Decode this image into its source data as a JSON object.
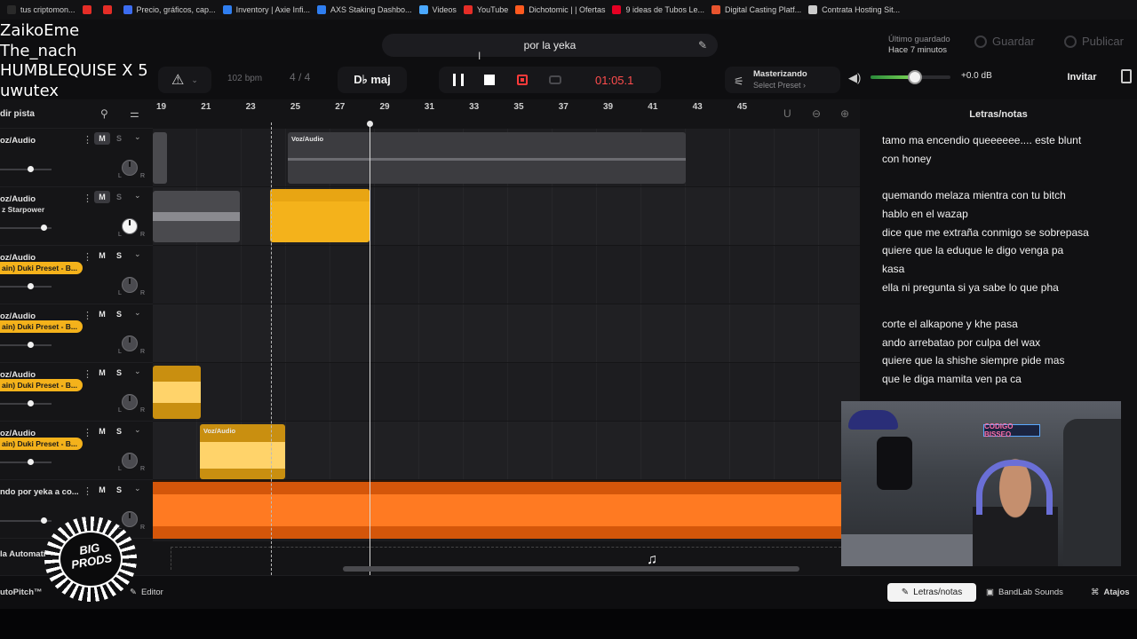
{
  "bookmarks": [
    {
      "label": "tus criptomon...",
      "color": "#2a2a2a"
    },
    {
      "label": "",
      "color": "#e52d27"
    },
    {
      "label": "",
      "color": "#e52d27"
    },
    {
      "label": "Precio, gráficos, cap...",
      "color": "#3c6cf0"
    },
    {
      "label": "Inventory | Axie Infi...",
      "color": "#2f7ef0"
    },
    {
      "label": "AXS Staking Dashbo...",
      "color": "#2f7ef0"
    },
    {
      "label": "Videos",
      "color": "#4aa8ff"
    },
    {
      "label": "YouTube",
      "color": "#e52d27"
    },
    {
      "label": "Dichotomic | | Ofertas",
      "color": "#ff5a1f"
    },
    {
      "label": "9 ideas de Tubos Le...",
      "color": "#e60023"
    },
    {
      "label": "Digital Casting Platf...",
      "color": "#e8542e"
    },
    {
      "label": "Contrata Hosting Sit...",
      "color": "#cccccc"
    }
  ],
  "overlay_names": [
    "ZaikoEme",
    "The_nach",
    "HUMBLEQUISE X 5",
    "uwutex"
  ],
  "header": {
    "project_name": "por la yeka",
    "saved_label": "Último guardado",
    "saved_time": "Hace 7 minutos",
    "save_label": "Guardar",
    "publish_label": "Publicar"
  },
  "transport": {
    "bpm_value": "102",
    "bpm_unit": "bpm",
    "time_signature": "4 / 4",
    "key": "D♭ maj",
    "time": "01:05.1",
    "mastering_title": "Masterizando",
    "mastering_preset": "Select Preset ›",
    "volume_db": "+0.0 dB",
    "volume_level": 0.55,
    "invite_label": "Invitar"
  },
  "tracks_header": {
    "add_track_label": "dir pista"
  },
  "ruler_ticks": [
    "19",
    "21",
    "23",
    "25",
    "27",
    "29",
    "31",
    "33",
    "35",
    "37",
    "39",
    "41",
    "43",
    "45"
  ],
  "tracks": [
    {
      "name": "oz/Audio",
      "preset": "",
      "mute": "M",
      "solo": "S",
      "mute_on": true,
      "solo_dim": true,
      "fader": 0.58,
      "pan_white": false,
      "pan_l": "L",
      "pan_r": "R"
    },
    {
      "name": "oz/Audio",
      "preset": "z Starpower",
      "mute": "M",
      "solo": "S",
      "mute_on": true,
      "solo_dim": true,
      "fader": 0.85,
      "pan_white": true,
      "pan_l": "L",
      "pan_r": "R"
    },
    {
      "name": "oz/Audio",
      "preset": "ain) Duki Preset - B...",
      "mute": "M",
      "solo": "S",
      "mute_on": false,
      "solo_dim": false,
      "fader": 0.58,
      "pan_white": false,
      "pan_l": "L",
      "pan_r": "R"
    },
    {
      "name": "oz/Audio",
      "preset": "ain) Duki Preset - B...",
      "mute": "M",
      "solo": "S",
      "mute_on": false,
      "solo_dim": false,
      "fader": 0.58,
      "pan_white": false,
      "pan_l": "L",
      "pan_r": "R"
    },
    {
      "name": "oz/Audio",
      "preset": "ain) Duki Preset - B...",
      "mute": "M",
      "solo": "S",
      "mute_on": false,
      "solo_dim": false,
      "fader": 0.58,
      "pan_white": false,
      "pan_l": "L",
      "pan_r": "R"
    },
    {
      "name": "oz/Audio",
      "preset": "ain) Duki Preset - B...",
      "mute": "M",
      "solo": "S",
      "mute_on": false,
      "solo_dim": false,
      "fader": 0.58,
      "pan_white": false,
      "pan_l": "L",
      "pan_r": "R"
    },
    {
      "name": "ndo por yeka a co...",
      "preset": "",
      "mute": "M",
      "solo": "S",
      "mute_on": false,
      "solo_dim": false,
      "fader": 0.85,
      "pan_white": false,
      "pan_l": "L",
      "pan_r": "R"
    }
  ],
  "automation_label": "la Automati",
  "clips": {
    "voz_label_1": "Voz/Audio",
    "voz_label_2": "Voz/Audio"
  },
  "lyrics": {
    "title": "Letras/notas",
    "lines": [
      " tamo ma encendio queeeeee.... este blunt",
      "con honey",
      "",
      "quemando melaza mientra con tu bitch",
      "hablo en el wazap",
      "dice que me extraña conmigo se sobrepasa",
      " quiere que la eduque le digo venga pa",
      "kasa",
      "ella ni pregunta si ya sabe lo que pha",
      "",
      " corte el alkapone y khe pasa",
      "ando arrebatao por culpa del wax",
      "quiere que la shishe siempre pide mas",
      "que  le diga mamita ven  pa ca"
    ]
  },
  "webcam": {
    "sign_text": "CODIGO BISSEO"
  },
  "footer": {
    "autopitch_label": "utoPitch™",
    "editor_label": "Editor",
    "lyrics_tab_label": "Letras/notas",
    "sounds_label": "BandLab Sounds",
    "shortcuts_label": "Atajos"
  },
  "logo": {
    "line1": "BIG",
    "line2": "PRODS"
  },
  "colors": {
    "accent_yellow": "#f4b21b",
    "accent_orange": "#ff6a10",
    "record_red": "#ff3a3a",
    "time_red": "#ff4d4d"
  }
}
